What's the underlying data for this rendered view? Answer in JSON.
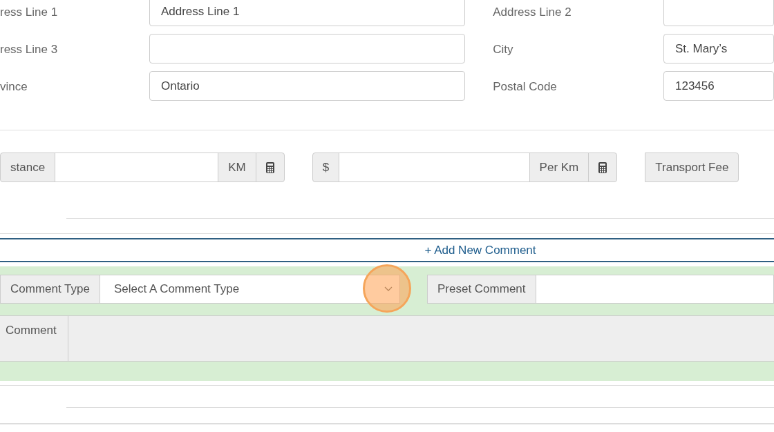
{
  "address_rows": [
    {
      "left": {
        "label": "ress Line 1",
        "value": "Address Line 1"
      },
      "right": {
        "label": "Address Line 2"
      }
    },
    {
      "left": {
        "label": "ress Line 3"
      },
      "right": {
        "label": "City",
        "value": "St. Mary’s"
      }
    },
    {
      "left": {
        "label": "vince",
        "value": "Ontario"
      },
      "right": {
        "label": "Postal Code",
        "value": "123456"
      }
    }
  ],
  "fees": {
    "distance": {
      "label": "stance",
      "unit": "KM"
    },
    "rate": {
      "prefix": "$",
      "unit": "Per Km"
    },
    "transport_fee": {
      "label": "Transport Fee"
    }
  },
  "add_comment": {
    "icon": "+",
    "label": "Add New Comment"
  },
  "comment_form": {
    "type_label": "Comment Type",
    "type_select": {
      "value": "Select A Comment Type"
    },
    "preset_label": "Preset Comment",
    "comment_label": "Comment"
  }
}
